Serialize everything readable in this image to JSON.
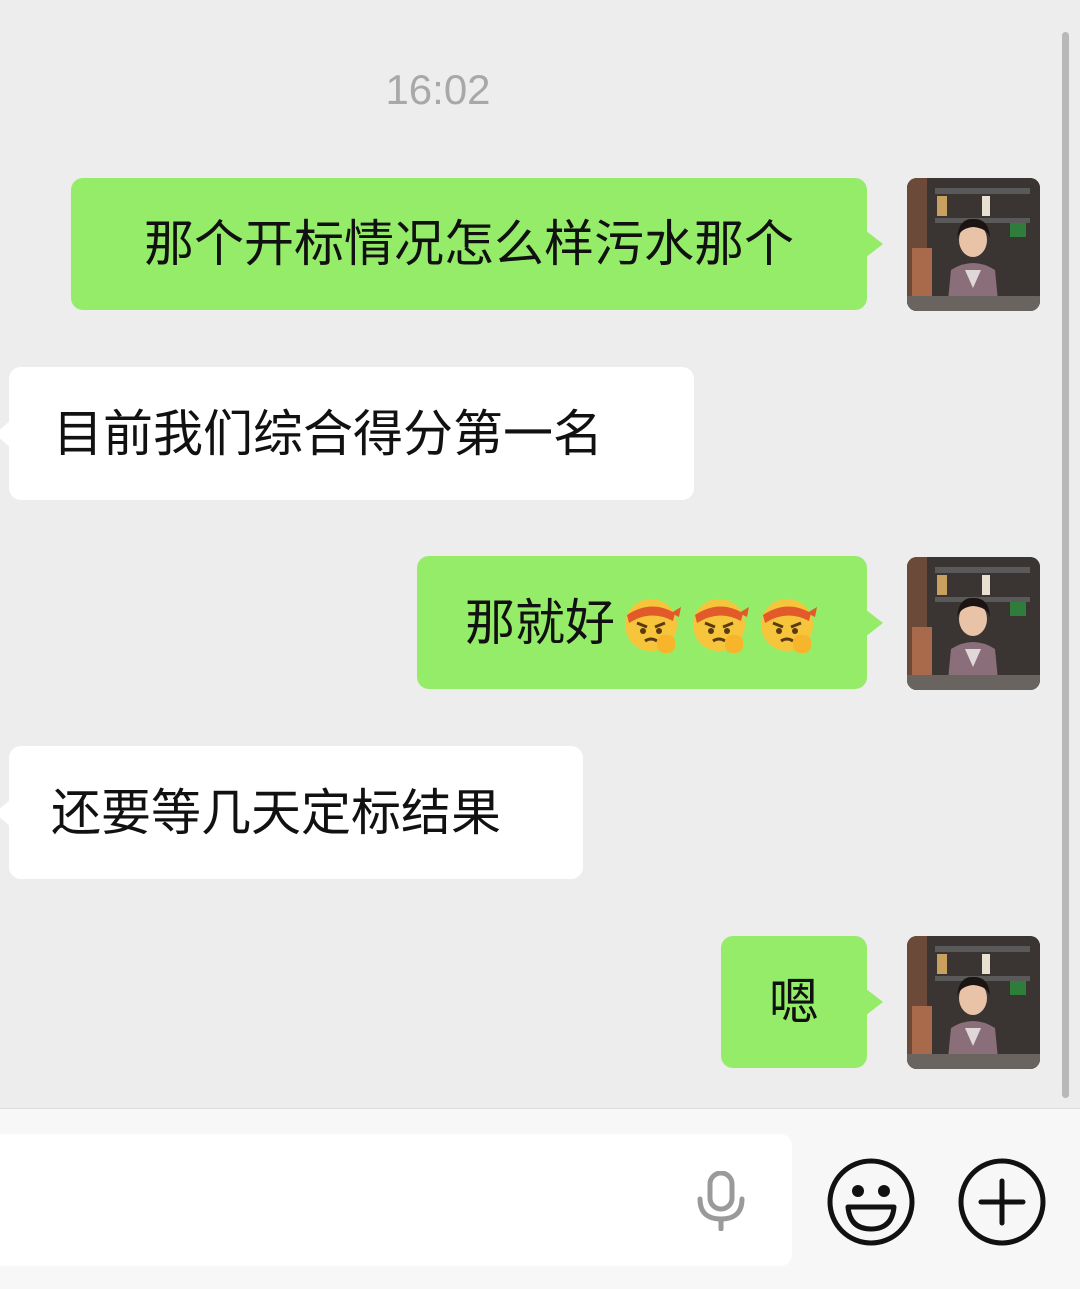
{
  "chat": {
    "timestamp": "16:02",
    "messages": [
      {
        "direction": "out",
        "text": "那个开标情况怎么样污水那个"
      },
      {
        "direction": "in",
        "text": "目前我们综合得分第一名"
      },
      {
        "direction": "out",
        "text": "那就好",
        "emoji": [
          "salute-face-emoji",
          "salute-face-emoji",
          "salute-face-emoji"
        ]
      },
      {
        "direction": "in",
        "text": "还要等几天定标结果"
      },
      {
        "direction": "out",
        "text": "嗯"
      }
    ]
  },
  "input_bar": {
    "icons": [
      "microphone-icon",
      "smiley-icon",
      "plus-icon"
    ]
  },
  "colors": {
    "background": "#ededed",
    "outgoing_bubble": "#95ec69",
    "incoming_bubble": "#ffffff",
    "timestamp": "#a8a8a8"
  }
}
